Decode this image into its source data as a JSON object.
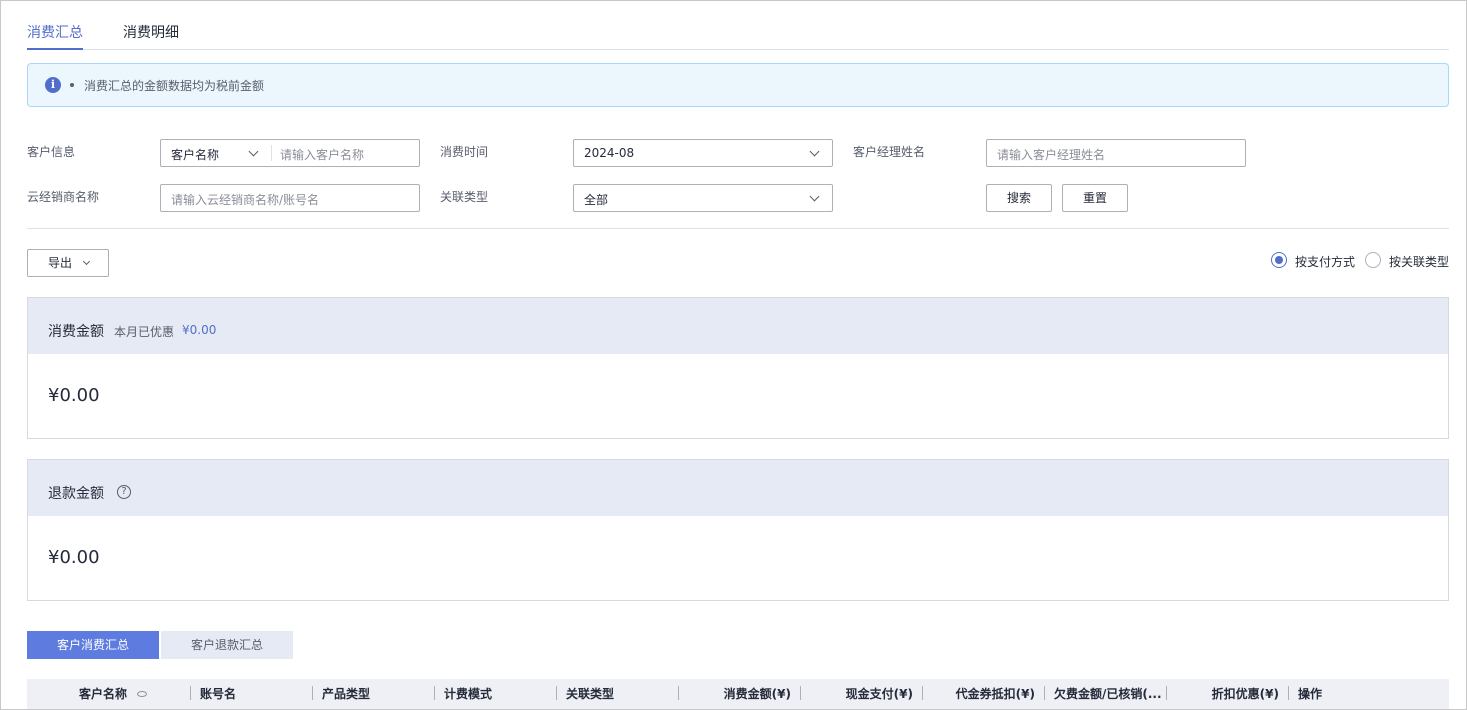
{
  "tabs": [
    {
      "label": "消费汇总",
      "active": true
    },
    {
      "label": "消费明细",
      "active": false
    }
  ],
  "notice": {
    "text": "消费汇总的金额数据均为税前金额",
    "icon": "info-icon"
  },
  "filters": {
    "customer_info_label": "客户信息",
    "customer_type_selected": "客户名称",
    "customer_name_placeholder": "请输入客户名称",
    "consume_time_label": "消费时间",
    "consume_time_value": "2024-08",
    "manager_label": "客户经理姓名",
    "manager_placeholder": "请输入客户经理姓名",
    "distributor_label": "云经销商名称",
    "distributor_placeholder": "请输入云经销商名称/账号名",
    "relation_label": "关联类型",
    "relation_value": "全部",
    "search_label": "搜索",
    "reset_label": "重置"
  },
  "toolbar": {
    "export_label": "导出",
    "radio_by_payment": "按支付方式",
    "radio_by_relation": "按关联类型",
    "selected": "by_payment"
  },
  "consume_card": {
    "title": "消费金额",
    "discount_label": "本月已优惠",
    "discount_value": "¥0.00",
    "amount": "¥0.00"
  },
  "refund_card": {
    "title": "退款金额",
    "amount": "¥0.00",
    "help_icon": "question-circle-icon"
  },
  "subtabs": [
    {
      "label": "客户消费汇总",
      "active": true
    },
    {
      "label": "客户退款汇总",
      "active": false
    }
  ],
  "table": {
    "columns": [
      "客户名称",
      "账号名",
      "产品类型",
      "计费模式",
      "关联类型",
      "消费金额(¥)",
      "现金支付(¥)",
      "代金券抵扣(¥)",
      "欠费金额/已核销(...",
      "折扣优惠(¥)",
      "操作"
    ]
  },
  "colors": {
    "accent": "#526ecc",
    "primary_button": "#5e7ce0",
    "card_header": "#e6eaf5",
    "notice_bg": "#ecf6fd"
  }
}
